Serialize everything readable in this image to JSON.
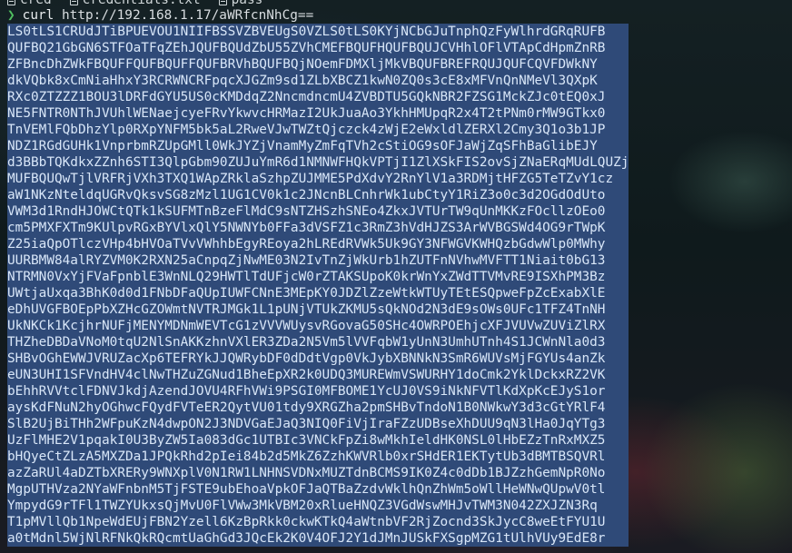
{
  "previous_line": {
    "items": [
      {
        "name": "cred",
        "icon": "folder-icon"
      },
      {
        "name": "credentials.txt",
        "icon": "file-icon"
      },
      {
        "name": "pass",
        "icon": "file-icon"
      }
    ]
  },
  "prompt": {
    "symbol": "❯",
    "command": "curl",
    "argument": "http://192.168.1.17/aWRfcnNhCg=="
  },
  "output_lines": [
    "LS0tLS1CRUdJTiBPUEVOU1NIIFBSSVZBVEUgS0VZLS0tLS0KYjNCbGJuTnphQzFyWlhrdGRqRUFB",
    "QUFBQ21GbGN6STFOaTFqZEhJQUFBQUdZbU55ZVhCMEFBQUFHQUFBQUJCVHhlOFlVTApCdHpmZnRB",
    "ZFBncDhZWkFBQUFFQUFBQUFFQUFBRVhBQUFBQjNOemFDMXljMkVBQUFBREFRQUJQUFCQVFDWkNY",
    "dkVQbk8xCmNiaHhxY3RCRWNCRFpqcXJGZm9sd1ZLbXBCZ1kwN0ZQ0s3cE8xMFVnQnNMeVl3QXpK",
    "RXc0ZTZZZ1BOU3lDRFdGYU5US0cKMDdqZ2NncmdncmU4ZVBDTU5GQkNBR2FZSG1MckZJc0tEQ0xJ",
    "NE5FNTR0NThJVUhlWENaejcyeFRvYkwvcHRMazI2UkJuaAo3YkhHMUpqR2x4T2tPNm0rMW9GTkx0",
    "TnVEMlFQbDhzYlp0RXpYNFM5bk5aL2RweVJwTWZtQjczck4zWjE2eWxldlZERXl2Cmy3Q1o3b1JP",
    "NDZ1RGdGUHk1VnprbmRZUpGMll0WkJYZjVnamMyZmFqTVh2cStiOG9sOFJaWjZqSFhBaGlibEJY",
    "d3BBbTQKdkxZZnh6STI3QlpGbm90ZUJuYmR6d1NMNWFHQkVPTjI1ZlXSkFIS2ovSjZNaERqMUdLQUZj",
    "MUFBQUQwTjlVRFRjVXh3TXQ1WApZRklaSzhpZUJMME5PdXdvY2RnYlV1a3RDMjtHFZG5TeTZvY1cz",
    "aW1NKzNteldqUGRvQksvSG8zMzl1UG1CV0k1c2JNcnBLCnhrWk1ubCtyY1RiZ3o0c3d2OGdOdUto",
    "VWM3d1RndHJOWCtQTk1kSUFMTnBzeFlMdC9sNTZHSzhSNEo4ZkxJVTUrTW9qUnMKKzFOcllzOEo0",
    "cm5PMXFXTm9KUlpvRGxBYVlxQlY5NWNYb0FFa3dVSFZ1c3RmZ3hVdHJZS3ArWVBGSWd4OG9rTWpK",
    "Z25iaQpOTlczVHp4bHVOaTVvVWhhbEgyREoya2hLREdRVWk5Uk9GY3NFWGVKWHQzbGdwWlp0MWhy",
    "UURBMW84alRYZVM0K2RXN25aCnpqZjNwME03N2IvTnZjWkUrb1hZUTFnNVhwMVFTT1Niait0bG13",
    "NTRMN0VxYjFVaFpnblE3WnNLQ29HWTlTdUFjcW0rZTAKSUpoK0krWnYxZWdTTVMvRE9ISXhPM3Bz",
    "UWtjaUxqa3BhK0d0d1FNbDFaQUpIUWFCNnE3MEpKY0JDZlZzeWtkWTUyTEtESQpweFpZcExabXlE",
    "eDhUVGFBOEpPbXZHcGZOWmtNVTRJMGk1L1pUNjVTUkZKMU5sQkNOd2N3dE9sOWs0UFc1TFZ4TnNH",
    "UkNKCk1KcjhrNUFjMENYMDNmWEVTcG1zVVVWUysvRGovaG50SHc4OWRPOEhjcXFJVUVwZUViZlRX",
    "THZheDBDaVNoM0tqU2NlSnAKKzhnVXlER3ZDa2N5Vm5lVVFqbW1yUnN3UmhUTnh4S1JCWnNla0d3",
    "SHBvOGhEWWJVRUZacXp6TEFRYkJJQWRybDF0dDdtVgp0VkJybXBNNkN3SmR6WUVsMjFGYUs4anZk",
    "eUN3UHI1SFVndHV4clNwTHZuZGNud1BheEpXR2k0UDQ3MUREWmVSWURHY1doCmk2YklDckxRZ2VK",
    "bEhhRVVtclFDNVJkdjAzendJOVU4RFhVWi9PSGI0MFBOME1YcUJ0VS9iNkNFVTlKdXpKcEJyS1or",
    "aysKdFNuN2hyOGhwcFQydFVTeER2QytVU01tdy9XRGZha2pmSHBvTndoN1B0NWkwY3d3cGtYRlF4",
    "SlB2UjBiTHh2WFpuKzN4dwpON2J3NDVGaEJaQ3NIQ0FiVjIraFZzUDBseXhDUU9qN3lHa0JqYTg3",
    "UzFlMHE2V1pqakI0U3ByZW5Ia083dGc1UTBIc3VNCkFpZi8wMkhIeldHK0NSL0lHbEZzTnRxMXZ5",
    "bHQyeCtZLzA5MXZDa1JPQkRhd2pIei84b2d5MkZ6ZzhKWVRlb0xrSHdER1EKTytUb3dBMTBSQVRl",
    "azZaRUl4aDZTbXRERy9WNXplV0N1RW1LNHNSVDNxMUZTdnBCMS9IK0Z4c0dDb1BJZzhGemNpR0No",
    "MgpUTHVza2NYaWFnbnM5TjFSTE9ubEhoaVpkOFJaQTBaZzdvWklhQnZhWm5oWllHeWNwQUpwV0tl",
    "YmpydG9rTFl1TWZYUkxsQjMvU0FlVWw3MkVBM20xRlueHNQZ3VGdWswMHJvTWM3N042ZXJZN3Rq",
    "T1pMVllQb1NpeWdEUjFBN2Yzell6KzBpRkk0ckwKTkQ4aWtnbVF2RjZocnd3SkJycC8weEtFYU1U",
    "a0tMdnl5WjNlRFNkQkRQcmtUaGhGd3JQcEk2K0V4OFJ2Y1dJMnJUSkFXSgpMZG1tUlhVUy9EdE8r"
  ]
}
